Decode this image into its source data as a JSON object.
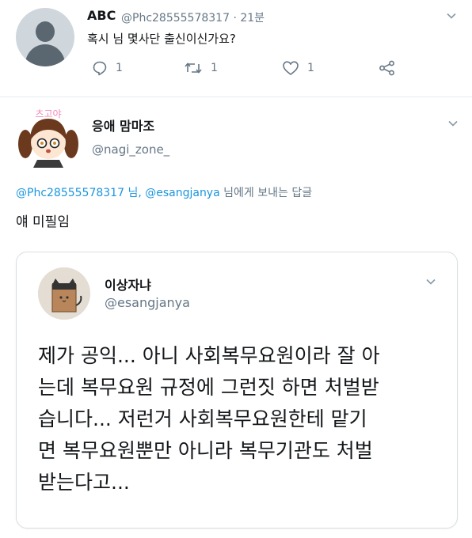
{
  "tweet": {
    "name": "ABC",
    "handle": "@Phc28555578317",
    "time": "· 21분",
    "text": "혹시 님 몇사단 출신이신가요?",
    "actions": {
      "reply_count": "1",
      "retweet_count": "1",
      "like_count": "1"
    }
  },
  "reply": {
    "logo_text": "츠고야",
    "name": "응애 맘마조",
    "handle": "@nagi_zone_",
    "reply_to": {
      "users": "@Phc28555578317 님, @esangjanya",
      "suffix": " 님에게 보내는 답글"
    },
    "text": "얘 미필임"
  },
  "quote": {
    "name": "이상자냐",
    "handle": "@esangjanya",
    "lines": [
      "제가 공익... 아니 사회복무요원이라 잘 아",
      "는데 복무요원 규정에 그런짓 하면 처벌받",
      "습니다... 저런거 사회복무요원한테 맡기",
      "면 복무요원뿐만 아니라 복무기관도 처벌",
      "받는다고..."
    ]
  },
  "colors": {
    "accent": "#1b95e0",
    "muted": "#657786",
    "text": "#14171a"
  }
}
